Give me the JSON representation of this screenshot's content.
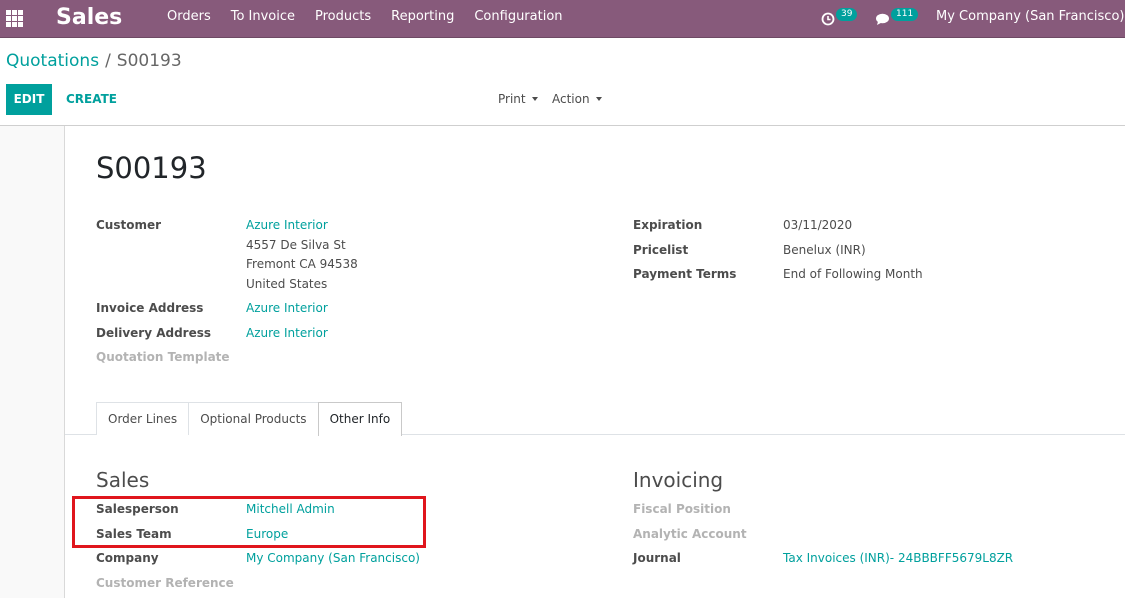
{
  "topbar": {
    "app_name": "Sales",
    "menu": [
      "Orders",
      "To Invoice",
      "Products",
      "Reporting",
      "Configuration"
    ],
    "activity_count": "39",
    "messages_count": "111",
    "company": "My Company (San Francisco)"
  },
  "breadcrumb": {
    "parent": "Quotations",
    "current": "S00193"
  },
  "buttons": {
    "edit": "EDIT",
    "create": "CREATE",
    "print": "Print",
    "action": "Action"
  },
  "record": {
    "name": "S00193",
    "customer_label": "Customer",
    "customer_name": "Azure Interior",
    "address_lines": [
      "4557 De Silva St",
      "Fremont CA 94538",
      "United States"
    ],
    "invoice_address_label": "Invoice Address",
    "invoice_address": "Azure Interior",
    "delivery_address_label": "Delivery Address",
    "delivery_address": "Azure Interior",
    "quotation_template_label": "Quotation Template",
    "expiration_label": "Expiration",
    "expiration": "03/11/2020",
    "pricelist_label": "Pricelist",
    "pricelist": "Benelux (INR)",
    "payment_terms_label": "Payment Terms",
    "payment_terms": "End of Following Month"
  },
  "tabs": [
    "Order Lines",
    "Optional Products",
    "Other Info"
  ],
  "active_tab": "Other Info",
  "other_info": {
    "sales_title": "Sales",
    "salesperson_label": "Salesperson",
    "salesperson": "Mitchell Admin",
    "sales_team_label": "Sales Team",
    "sales_team": "Europe",
    "company_label": "Company",
    "company": "My Company (San Francisco)",
    "customer_reference_label": "Customer Reference",
    "invoicing_title": "Invoicing",
    "fiscal_position_label": "Fiscal Position",
    "analytic_account_label": "Analytic Account",
    "journal_label": "Journal",
    "journal": "Tax Invoices (INR)- 24BBBFF5679L8ZR"
  },
  "colors": {
    "brand": "#875a7b",
    "accent": "#00a09d",
    "highlight": "#e0161d"
  },
  "icons": {
    "apps": "apps-grid-icon",
    "activity": "clock-icon",
    "messages": "chat-icon",
    "caret": "caret-down-icon"
  }
}
